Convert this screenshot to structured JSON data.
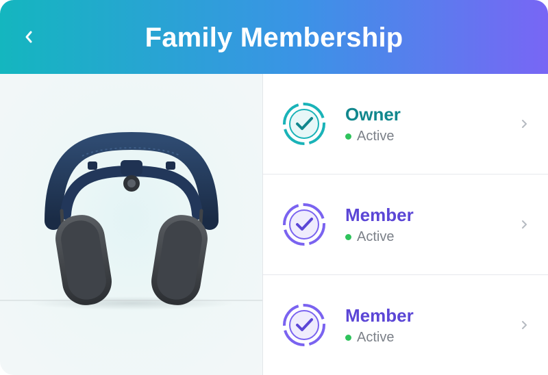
{
  "header": {
    "title": "Family Membership",
    "back_icon": "chevron-left-icon",
    "gradient": [
      "#14b6bf",
      "#3b93e6",
      "#7866f5"
    ]
  },
  "product": {
    "icon": "headphones-image"
  },
  "members": [
    {
      "role": "Owner",
      "status": "Active",
      "color": "#11878d",
      "badge_color": "#1ab3b8",
      "icon": "verified-check-icon"
    },
    {
      "role": "Member",
      "status": "Active",
      "color": "#5b46d6",
      "badge_color": "#7a63f0",
      "icon": "verified-check-icon"
    },
    {
      "role": "Member",
      "status": "Active",
      "color": "#5b46d6",
      "badge_color": "#7a63f0",
      "icon": "verified-check-icon"
    }
  ],
  "status_color": "#2fc35c"
}
